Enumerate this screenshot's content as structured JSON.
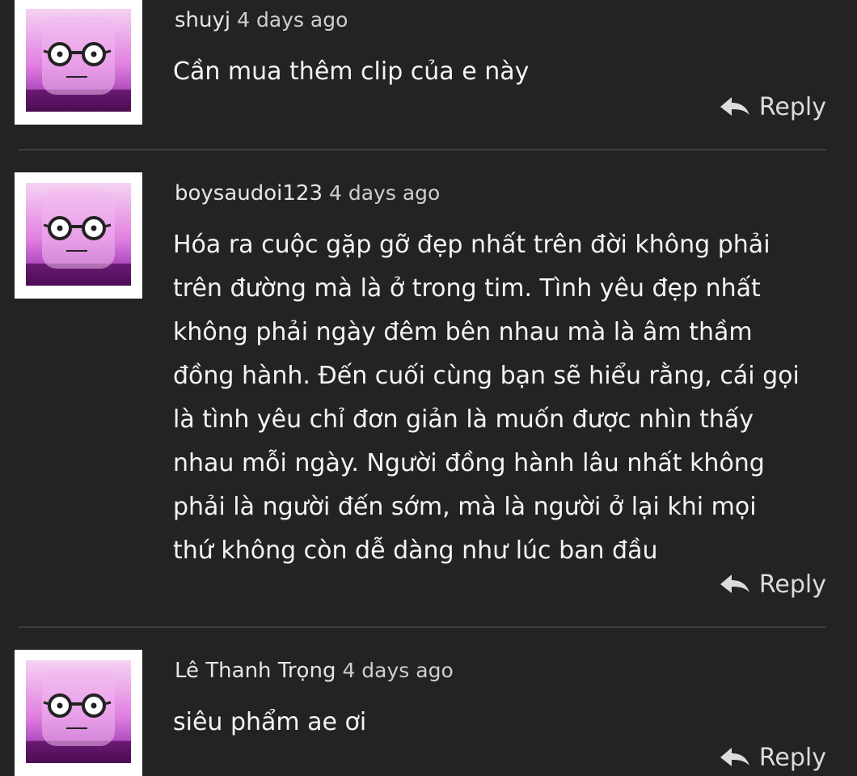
{
  "comments": [
    {
      "author": "shuyj",
      "time": "4 days ago",
      "text": "Cần mua thêm clip của e này",
      "reply_label": "Reply"
    },
    {
      "author": "boysaudoi123",
      "time": "4 days ago",
      "text": "Hóa ra cuộc gặp gỡ đẹp nhất trên đời không phải\ntrên đường mà là ở trong tim. Tình yêu đẹp nhất\nkhông phải ngày đêm bên nhau mà là âm thầm\nđồng hành. Đến cuối cùng bạn sẽ hiểu rằng, cái gọi\nlà tình yêu chỉ đơn giản là muốn được nhìn thấy\nnhau mỗi ngày. Người đồng hành lâu nhất không\nphải là người đến sớm, mà là người ở lại khi mọi\nthứ không còn dễ dàng như lúc ban đầu",
      "reply_label": "Reply"
    },
    {
      "author": "Lê Thanh Trọng",
      "time": "4 days ago",
      "text": "siêu phẩm ae ơi",
      "reply_label": "Reply"
    }
  ],
  "icons": {
    "avatar": "glasses-face-avatar",
    "reply": "reply-arrow-icon"
  },
  "colors": {
    "background": "#232323",
    "avatar_top": "#f3c7ef",
    "avatar_bottom": "#5b0f63"
  }
}
